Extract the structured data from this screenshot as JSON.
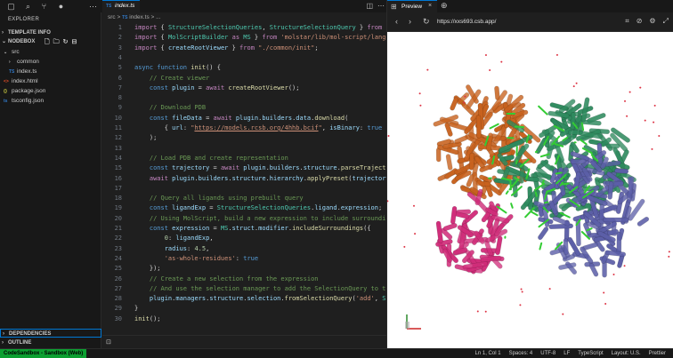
{
  "sidebar": {
    "title": "EXPLORER",
    "template_info": "TEMPLATE INFO",
    "workspace": "NODEBOX",
    "tree": [
      {
        "label": "src",
        "type": "folder",
        "depth": 0
      },
      {
        "label": "common",
        "type": "folder",
        "depth": 1
      },
      {
        "label": "index.ts",
        "type": "ts",
        "depth": 1
      },
      {
        "label": "index.html",
        "type": "html",
        "depth": 0
      },
      {
        "label": "package.json",
        "type": "json",
        "depth": 0
      },
      {
        "label": "tsconfig.json",
        "type": "tsconfig",
        "depth": 0
      }
    ],
    "dependencies": "DEPENDENCIES",
    "outline": "OUTLINE"
  },
  "editor": {
    "tab": "index.ts",
    "breadcrumb_folder": "src",
    "breadcrumb_sep": ">",
    "breadcrumb_file": "index.ts",
    "breadcrumb_more": "> ..."
  },
  "code_lines": [
    {
      "n": "1",
      "html": "<span class=\"kw\">import</span> { <span class=\"type\">StructureSelectionQueries</span>, <span class=\"type\">StructureSelectionQuery</span> } <span class=\"kw\">from</span> <span class=\"str\">'</span>"
    },
    {
      "n": "2",
      "html": "<span class=\"kw\">import</span> { <span class=\"type\">MolScriptBuilder</span> <span class=\"kw\">as</span> <span class=\"type\">MS</span> } <span class=\"kw\">from</span> <span class=\"str\">'molstar/lib/mol-script/langu</span>"
    },
    {
      "n": "3",
      "html": "<span class=\"kw\">import</span> { <span class=\"var\">createRootViewer</span> } <span class=\"kw\">from</span> <span class=\"str\">\"./common/init\"</span>;"
    },
    {
      "n": "4",
      "html": ""
    },
    {
      "n": "5",
      "html": "<span class=\"kw2\">async</span> <span class=\"kw2\">function</span> <span class=\"fn\">init</span>() {"
    },
    {
      "n": "6",
      "html": "    <span class=\"cm\">// Create viewer</span>"
    },
    {
      "n": "7",
      "html": "    <span class=\"kw2\">const</span> <span class=\"var\">plugin</span> = <span class=\"kw\">await</span> <span class=\"fn\">createRootViewer</span>();"
    },
    {
      "n": "8",
      "html": ""
    },
    {
      "n": "9",
      "html": "    <span class=\"cm\">// Download PDB</span>"
    },
    {
      "n": "10",
      "html": "    <span class=\"kw2\">const</span> <span class=\"var\">fileData</span> = <span class=\"kw\">await</span> <span class=\"var\">plugin</span>.<span class=\"var\">builders</span>.<span class=\"var\">data</span>.<span class=\"fn\">download</span>("
    },
    {
      "n": "11",
      "html": "        { <span class=\"var\">url</span>: <span class=\"str\">\"</span><span class=\"url\">https://models.rcsb.org/4hhb.bcif</span><span class=\"str\">\"</span>, <span class=\"var\">isBinary</span>: <span class=\"kw2\">true</span>"
    },
    {
      "n": "12",
      "html": "    );"
    },
    {
      "n": "13",
      "html": ""
    },
    {
      "n": "14",
      "html": "    <span class=\"cm\">// Load PDB and create representation</span>"
    },
    {
      "n": "15",
      "html": "    <span class=\"kw2\">const</span> <span class=\"var\">trajectory</span> = <span class=\"kw\">await</span> <span class=\"var\">plugin</span>.<span class=\"var\">builders</span>.<span class=\"var\">structure</span>.<span class=\"fn\">parseTrajecto</span>"
    },
    {
      "n": "16",
      "html": "    <span class=\"kw\">await</span> <span class=\"var\">plugin</span>.<span class=\"var\">builders</span>.<span class=\"var\">structure</span>.<span class=\"var\">hierarchy</span>.<span class=\"fn\">applyPreset</span>(<span class=\"var\">trajectory</span>"
    },
    {
      "n": "17",
      "html": ""
    },
    {
      "n": "18",
      "html": "    <span class=\"cm\">// Query all ligands using prebuilt query</span>"
    },
    {
      "n": "19",
      "html": "    <span class=\"kw2\">const</span> <span class=\"var\">ligandExp</span> = <span class=\"type\">StructureSelectionQueries</span>.<span class=\"var\">ligand</span>.<span class=\"var\">expression</span>;"
    },
    {
      "n": "20",
      "html": "    <span class=\"cm\">// Using MolScript, build a new expression to include surroundi</span>"
    },
    {
      "n": "21",
      "html": "    <span class=\"kw2\">const</span> <span class=\"var\">expression</span> = <span class=\"type\">MS</span>.<span class=\"var\">struct</span>.<span class=\"var\">modifier</span>.<span class=\"fn\">includeSurroundings</span>({"
    },
    {
      "n": "22",
      "html": "        <span class=\"num2\">0</span>: <span class=\"var\">ligandExp</span>,"
    },
    {
      "n": "23",
      "html": "        <span class=\"var\">radius</span>: <span class=\"num2\">4.5</span>,"
    },
    {
      "n": "24",
      "html": "        <span class=\"str\">'as-whole-residues'</span>: <span class=\"kw2\">true</span>"
    },
    {
      "n": "25",
      "html": "    });"
    },
    {
      "n": "26",
      "html": "    <span class=\"cm\">// Create a new selection from the expression</span>"
    },
    {
      "n": "27",
      "html": "    <span class=\"cm\">// And use the selection manager to add the SelectionQuery to th</span>"
    },
    {
      "n": "28",
      "html": "    <span class=\"var\">plugin</span>.<span class=\"var\">managers</span>.<span class=\"var\">structure</span>.<span class=\"var\">selection</span>.<span class=\"fn\">fromSelectionQuery</span>(<span class=\"str\">'add'</span>, <span class=\"type\">S</span>"
    },
    {
      "n": "29",
      "html": "}"
    },
    {
      "n": "30",
      "html": "<span class=\"fn\">init</span>();"
    }
  ],
  "preview": {
    "tab": "Preview",
    "url": "https://xxs693.csb.app/"
  },
  "statusbar": {
    "left": "CodeSandbox - Sandbox (Web)",
    "items": [
      "Ln 1, Col 1",
      "Spaces: 4",
      "UTF-8",
      "LF",
      "TypeScript",
      "Layout: U.S.",
      "Prettier"
    ]
  },
  "colors": {
    "accent": "#0078d4",
    "status_green": "#0c9f31",
    "chain_a": "#c8621e",
    "chain_b": "#d12d7a",
    "chain_c": "#2e8a5e",
    "chain_d": "#5c5fa8",
    "ligand": "#33cc33"
  }
}
